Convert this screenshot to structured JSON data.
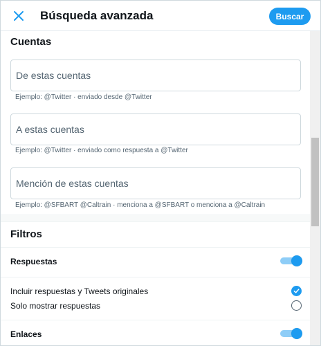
{
  "header": {
    "title": "Búsqueda avanzada",
    "search_button": "Buscar"
  },
  "accounts": {
    "section_title": "Cuentas",
    "from": {
      "placeholder": "De estas cuentas",
      "hint": "Ejemplo: @Twitter · enviado desde @Twitter"
    },
    "to": {
      "placeholder": "A estas cuentas",
      "hint": "Ejemplo: @Twitter · enviado como respuesta a @Twitter"
    },
    "mentioning": {
      "placeholder": "Mención de estas cuentas",
      "hint": "Ejemplo: @SFBART @Caltrain · menciona a @SFBART o menciona a @Caltrain"
    }
  },
  "filters": {
    "section_title": "Filtros",
    "replies": {
      "label": "Respuestas",
      "enabled": true,
      "options": [
        {
          "label": "Incluir respuestas y Tweets originales",
          "selected": true
        },
        {
          "label": "Solo mostrar respuestas",
          "selected": false
        }
      ]
    },
    "links": {
      "label": "Enlaces",
      "enabled": true
    }
  },
  "colors": {
    "accent": "#1d9bf0",
    "toggle_track": "#8ecdf7",
    "text_primary": "#0f1419",
    "text_secondary": "#536471",
    "border": "#cfd9de"
  }
}
